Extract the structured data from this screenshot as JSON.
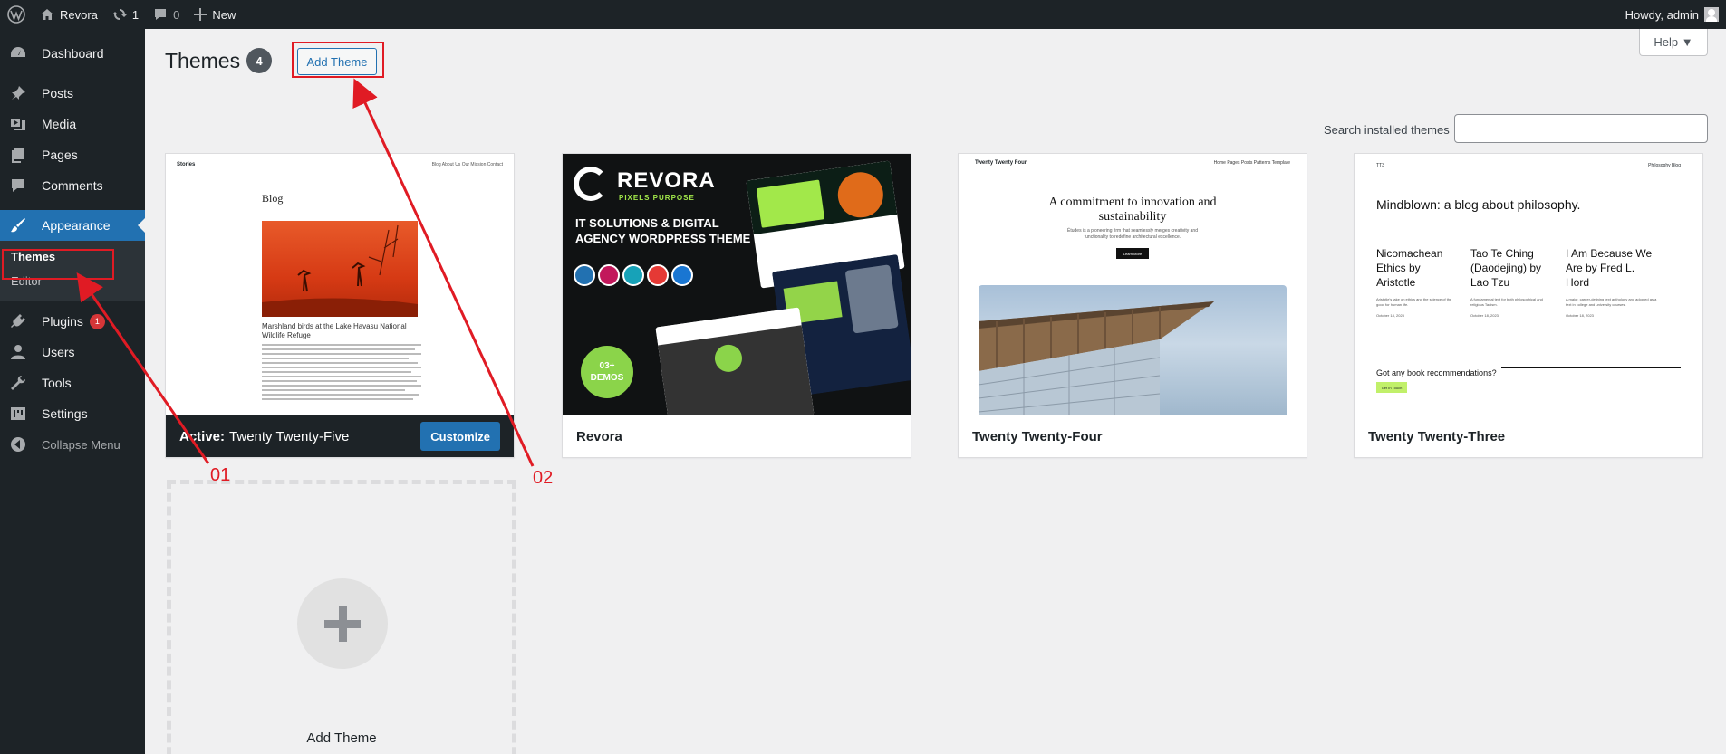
{
  "adminbar": {
    "site_name": "Revora",
    "updates_count": "1",
    "comments_count": "0",
    "new_label": "New",
    "greeting": "Howdy, admin"
  },
  "sidebar": {
    "items": [
      {
        "label": "Dashboard",
        "icon": "dashboard-icon"
      },
      {
        "label": "Posts",
        "icon": "pin-icon"
      },
      {
        "label": "Media",
        "icon": "media-icon"
      },
      {
        "label": "Pages",
        "icon": "pages-icon"
      },
      {
        "label": "Comments",
        "icon": "comment-icon"
      },
      {
        "label": "Appearance",
        "icon": "brush-icon"
      },
      {
        "label": "Plugins",
        "icon": "plugin-icon",
        "badge": "1"
      },
      {
        "label": "Users",
        "icon": "users-icon"
      },
      {
        "label": "Tools",
        "icon": "wrench-icon"
      },
      {
        "label": "Settings",
        "icon": "settings-icon"
      },
      {
        "label": "Collapse Menu",
        "icon": "collapse-icon"
      }
    ],
    "appearance_submenu": [
      {
        "label": "Themes",
        "active": true
      },
      {
        "label": "Editor",
        "active": false
      }
    ]
  },
  "main": {
    "help_label": "Help ▼",
    "title": "Themes",
    "theme_count": "4",
    "add_button": "Add Theme",
    "search_label": "Search installed themes",
    "search_value": "",
    "themes": [
      {
        "name": "Twenty Twenty-Five",
        "active": true,
        "active_prefix": "Active:",
        "action": "Customize"
      },
      {
        "name": "Revora"
      },
      {
        "name": "Twenty Twenty-Four"
      },
      {
        "name": "Twenty Twenty-Three"
      }
    ],
    "add_theme_card_label": "Add Theme"
  },
  "previews": {
    "tt5": {
      "brand": "Stories",
      "nav": "Blog   About Us   Our Mission   Contact",
      "heading": "Blog",
      "caption": "Marshland birds at the Lake Havasu National Wildlife Refuge"
    },
    "revora": {
      "brand": "REVORA",
      "tagline": "PIXELS PURPOSE",
      "headline": "IT SOLUTIONS & DIGITAL AGENCY WORDPRESS THEME",
      "demos": "03+",
      "demos_label": "DEMOS"
    },
    "tt4": {
      "brand": "Twenty Twenty Four",
      "nav": "Home   Pages   Posts   Patterns   Template",
      "heading": "A commitment to innovation and sustainability",
      "sub": "Études is a pioneering firm that seamlessly merges creativity and functionality to redefine architectural excellence.",
      "button": "Learn More"
    },
    "tt3": {
      "brand": "TT3",
      "nav": "Philosophy   Blog",
      "heading": "Mindblown: a blog about philosophy.",
      "posts": [
        {
          "title": "Nicomachean Ethics by Aristotle",
          "desc": "Aristotle's take on ethics and the science of the good for human life.",
          "date": "October 18, 2023"
        },
        {
          "title": "Tao Te Ching (Daodejing) by Lao Tzu",
          "desc": "A fundamental text for both philosophical and religious Taoism.",
          "date": "October 18, 2023"
        },
        {
          "title": "I Am Because We Are by Fred L. Hord",
          "desc": "A major, career-defining text anthology and adopted as a text in college and university courses.",
          "date": "October 18, 2023"
        }
      ],
      "question": "Got any book recommendations?",
      "button": "Get In Touch"
    }
  },
  "annotations": {
    "label_1": "01",
    "label_2": "02",
    "color": "#e01b24"
  },
  "colors": {
    "accent": "#2271b1",
    "sidebar_bg": "#1d2327",
    "badge": "#d63638"
  }
}
